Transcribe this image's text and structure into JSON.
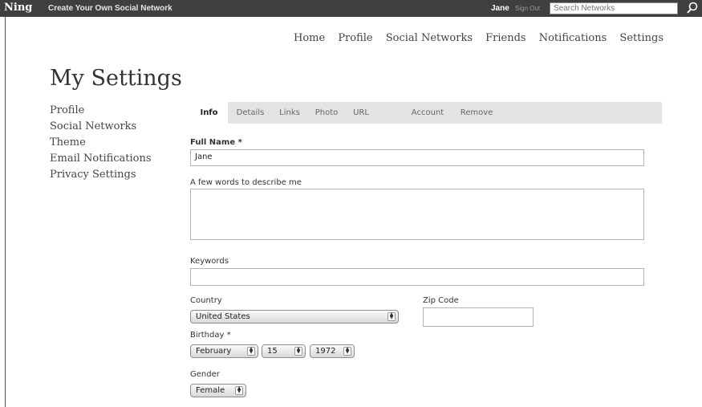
{
  "topbar": {
    "logo": "Ning",
    "create_link": "Create Your Own Social Network",
    "user": "Jane",
    "sign_out": "Sign Out",
    "search_placeholder": "Search Networks"
  },
  "nav": {
    "items": [
      "Home",
      "Profile",
      "Social Networks",
      "Friends",
      "Notifications",
      "Settings"
    ]
  },
  "page_title": "My Settings",
  "sidebar": {
    "items": [
      "Profile",
      "Social Networks",
      "Theme",
      "Email Notifications",
      "Privacy Settings"
    ]
  },
  "tabs": {
    "items": [
      "Info",
      "Details",
      "Links",
      "Photo",
      "URL",
      "Account",
      "Remove"
    ],
    "active": "Info"
  },
  "form": {
    "full_name_label": "Full Name *",
    "full_name_value": "Jane",
    "describe_label": "A few words to describe me",
    "describe_value": "",
    "keywords_label": "Keywords",
    "keywords_value": "",
    "country_label": "Country",
    "country_value": "United States",
    "zip_label": "Zip Code",
    "zip_value": "",
    "birthday_label": "Birthday *",
    "birthday_month": "February",
    "birthday_day": "15",
    "birthday_year": "1972",
    "gender_label": "Gender",
    "gender_value": "Female"
  }
}
